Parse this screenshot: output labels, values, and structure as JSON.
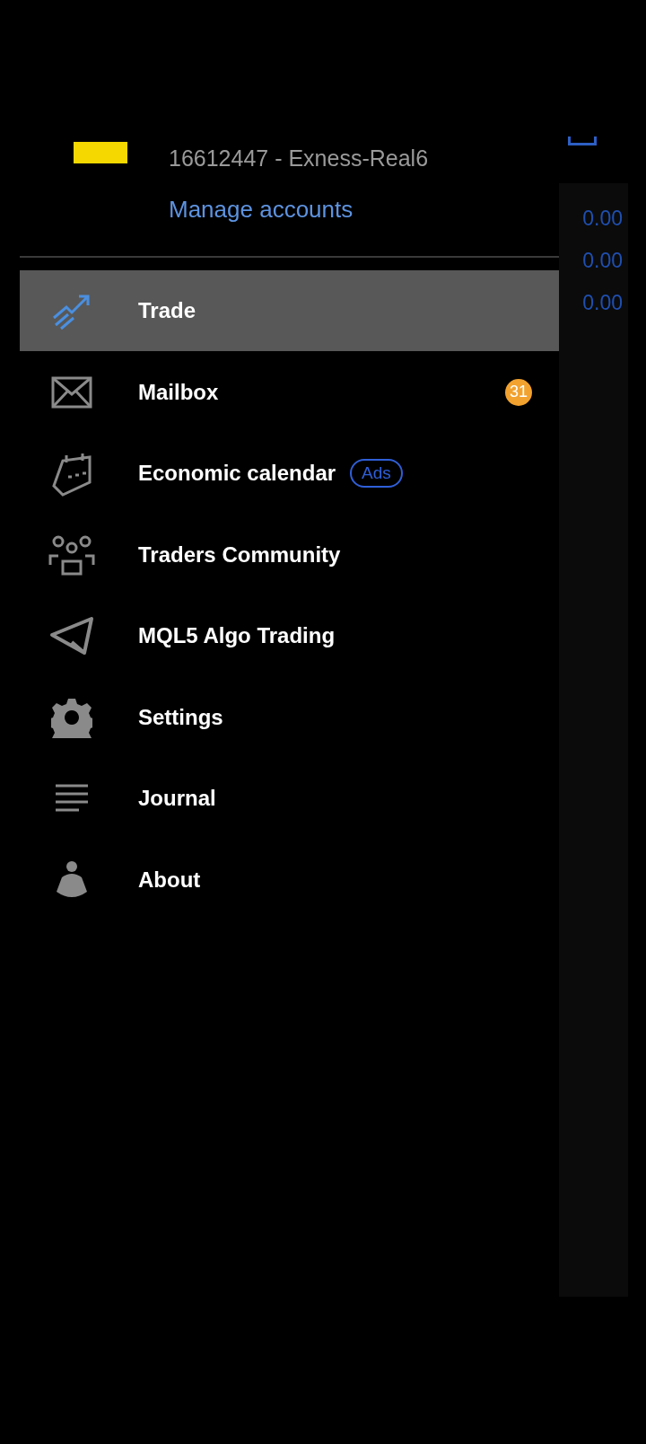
{
  "account": {
    "label": "16612447 - Exness-Real6",
    "manage_link": "Manage accounts"
  },
  "menu": [
    {
      "label": "Trade",
      "selected": true
    },
    {
      "label": "Mailbox",
      "selected": false,
      "badge": "31"
    },
    {
      "label": "Economic calendar",
      "selected": false,
      "tag": "Ads"
    },
    {
      "label": "Traders Community",
      "selected": false
    },
    {
      "label": "MQL5 Algo Trading",
      "selected": false
    },
    {
      "label": "Settings",
      "selected": false
    },
    {
      "label": "Journal",
      "selected": false
    },
    {
      "label": "About",
      "selected": false
    }
  ],
  "background_values": [
    "0.00",
    "0.00",
    "0.00"
  ]
}
